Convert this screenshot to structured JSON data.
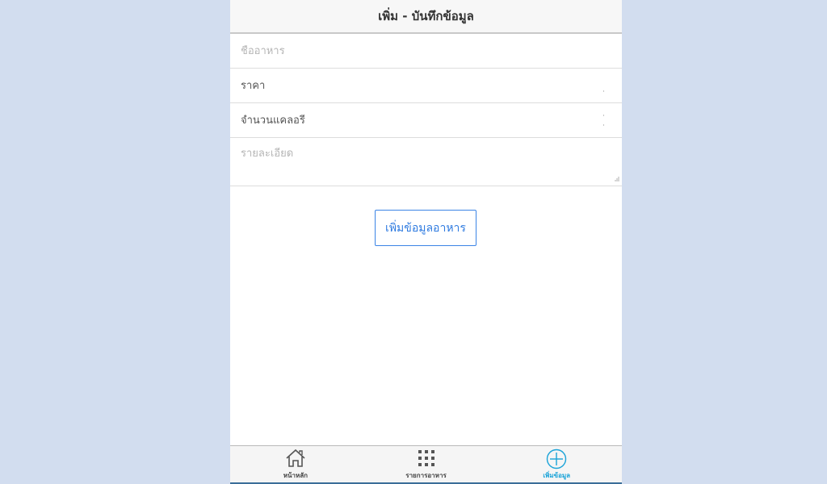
{
  "header": {
    "title": "เพิ่ม - บันทึกข้อมูล"
  },
  "form": {
    "name_placeholder": "ชื่ออาหาร",
    "price_placeholder": "ราคา",
    "calories_placeholder": "จำนวนแคลอรี่",
    "detail_placeholder": "รายละเอียด",
    "submit_label": "เพิ่มข้อมูลอาหาร"
  },
  "tabbar": {
    "tabs": [
      {
        "label": "หน้าหลัก",
        "icon": "home-icon",
        "active": false
      },
      {
        "label": "รายการอาหาร",
        "icon": "grid-icon",
        "active": false
      },
      {
        "label": "เพิ่มข้อมูล",
        "icon": "plus-circle-icon",
        "active": true
      }
    ],
    "active_color": "#1aa3d8"
  },
  "colors": {
    "background": "#d2ddef",
    "button_border": "#3b84e6",
    "button_text": "#2f7be0"
  }
}
